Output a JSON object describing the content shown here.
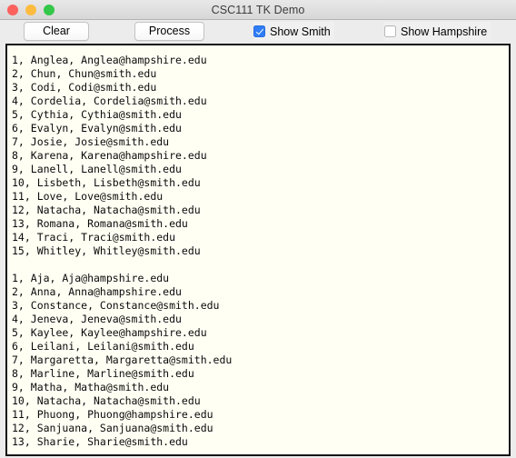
{
  "window": {
    "title": "CSC111 TK Demo",
    "traffic_lights": [
      {
        "name": "close",
        "color": "#fc615d"
      },
      {
        "name": "minimize",
        "color": "#fdbc40"
      },
      {
        "name": "zoom",
        "color": "#34c749"
      }
    ]
  },
  "toolbar": {
    "clear_label": "Clear",
    "process_label": "Process",
    "show_smith": {
      "label": "Show Smith",
      "checked": true
    },
    "show_hampshire": {
      "label": "Show Hampshire",
      "checked": false
    },
    "accent_color": "#2f7cf6"
  },
  "text_output": {
    "background": "#fffff4",
    "blocks": [
      {
        "lines": [
          "1, Anglea, Anglea@hampshire.edu",
          "2, Chun, Chun@smith.edu",
          "3, Codi, Codi@smith.edu",
          "4, Cordelia, Cordelia@smith.edu",
          "5, Cythia, Cythia@smith.edu",
          "6, Evalyn, Evalyn@smith.edu",
          "7, Josie, Josie@smith.edu",
          "8, Karena, Karena@hampshire.edu",
          "9, Lanell, Lanell@smith.edu",
          "10, Lisbeth, Lisbeth@smith.edu",
          "11, Love, Love@smith.edu",
          "12, Natacha, Natacha@smith.edu",
          "13, Romana, Romana@smith.edu",
          "14, Traci, Traci@smith.edu",
          "15, Whitley, Whitley@smith.edu"
        ]
      },
      {
        "lines": [
          "1, Aja, Aja@hampshire.edu",
          "2, Anna, Anna@hampshire.edu",
          "3, Constance, Constance@smith.edu",
          "4, Jeneva, Jeneva@smith.edu",
          "5, Kaylee, Kaylee@hampshire.edu",
          "6, Leilani, Leilani@smith.edu",
          "7, Margaretta, Margaretta@smith.edu",
          "8, Marline, Marline@smith.edu",
          "9, Matha, Matha@smith.edu",
          "10, Natacha, Natacha@smith.edu",
          "11, Phuong, Phuong@hampshire.edu",
          "12, Sanjuana, Sanjuana@smith.edu",
          "13, Sharie, Sharie@smith.edu"
        ]
      }
    ]
  }
}
